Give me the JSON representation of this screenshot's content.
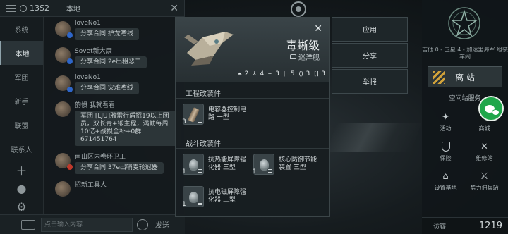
{
  "chat": {
    "online_count": "13S2",
    "channel_title": "本地",
    "tabs": [
      {
        "label": "系统"
      },
      {
        "label": "本地"
      },
      {
        "label": "军团"
      },
      {
        "label": "新手"
      },
      {
        "label": "联盟"
      },
      {
        "label": "联系人"
      }
    ],
    "messages": [
      {
        "name": "loveNo1",
        "text": "分享合同 护龙嗜线"
      },
      {
        "name": "Sovet新大康",
        "text": "分享合同 2e出租恶二"
      },
      {
        "name": "loveNo1",
        "text": "分享合同 灾难嗜线"
      },
      {
        "name": "韵惯 我就看看",
        "text": "军团 [LJU]雅雷行盾招19以上团员，双长青+锻主程，满勤每周10亿+战损全补+0群671451764"
      },
      {
        "name": "南山区内卷环卫工",
        "text": "分享合同 37e出哨麦轮冠器"
      },
      {
        "name": "招新工具人",
        "text": ""
      }
    ],
    "input_placeholder": "点击输入内容",
    "send_label": "发送"
  },
  "modal": {
    "ship_name": "毒蜥级",
    "ship_class": "巡洋舰",
    "slots": [
      "2",
      "4",
      "3",
      "5",
      "3",
      "3"
    ],
    "engineering_title": "工程改装件",
    "engineering_modules": [
      {
        "level": "3",
        "label": "电容器控制电路 一型"
      }
    ],
    "combat_title": "战斗改装件",
    "combat_modules": [
      {
        "level": "1",
        "label": "抗热能屏障强化器 三型"
      },
      {
        "level": "1",
        "label": "核心防御节能装置 三型"
      },
      {
        "level": "1",
        "label": "抗电磁屏障强化器 三型"
      }
    ]
  },
  "actions": [
    {
      "label": "应用"
    },
    {
      "label": "分享"
    },
    {
      "label": "举报"
    }
  ],
  "hud": {
    "location": "吉他 0 - 卫星 4 - 加达里海军 组装车间",
    "dock_label": "离 站",
    "services_title": "空间站服务",
    "services": [
      {
        "label": "活动",
        "icon": "party-icon"
      },
      {
        "label": "商城",
        "icon": "store-icon"
      },
      {
        "label": "保险",
        "icon": "insurance-icon"
      },
      {
        "label": "维修站",
        "icon": "repair-icon"
      },
      {
        "label": "设置基地",
        "icon": "base-icon"
      },
      {
        "label": "势力佣兵站",
        "icon": "mercenary-icon"
      }
    ],
    "visitor_label": "访客",
    "visitor_count": "1219"
  }
}
